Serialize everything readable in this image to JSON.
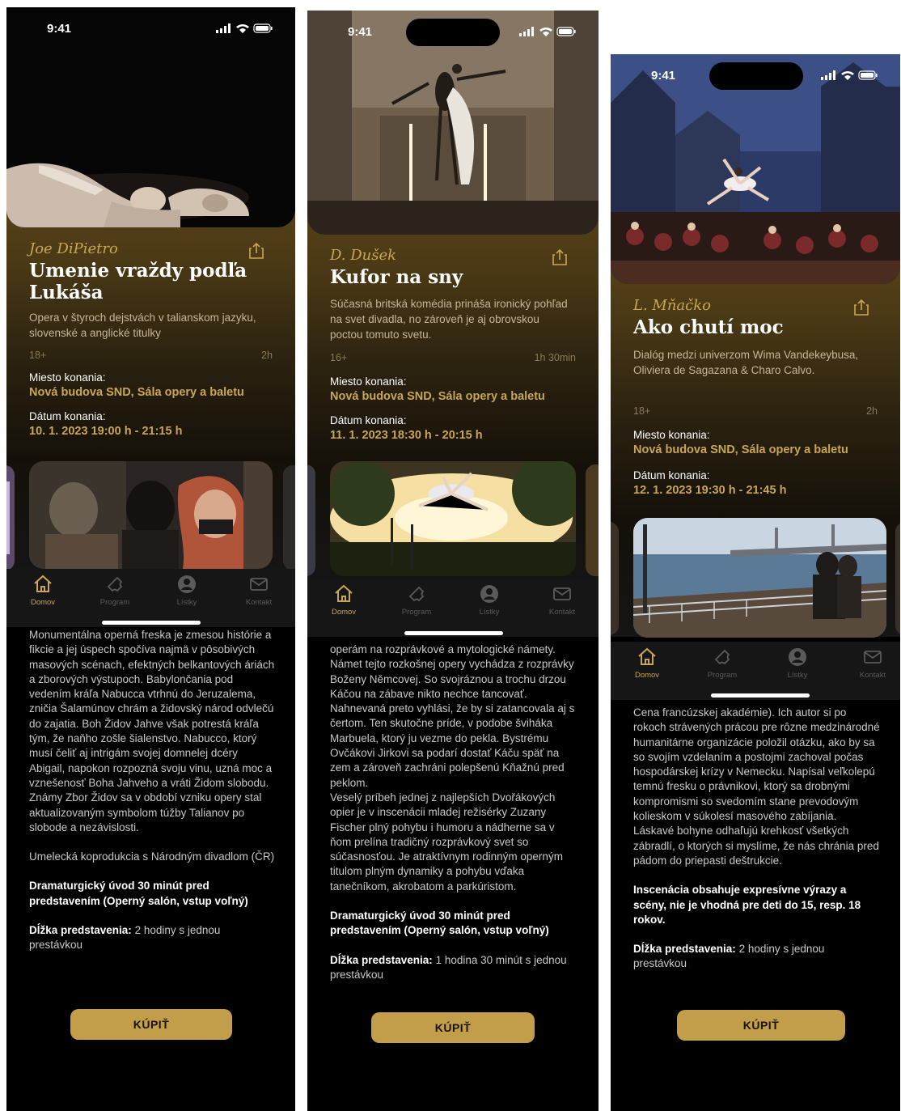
{
  "screens": [
    {
      "status_time": "9:41",
      "author": "Joe DiPietro",
      "title": "Umenie vraždy podľa Lukáša",
      "description": "Opera v štyroch dejstvách v talianskom jazyku, slovenské a anglické titulky",
      "age": "18+",
      "duration": "2h",
      "venue_label": "Miesto konania:",
      "venue": "Nová budova SND, Sála opery a baletu",
      "date_label": "Dátum konania:",
      "date": "10. 1. 2023 19:00 h - 21:15 h",
      "tabs": [
        "Domov",
        "Program",
        "Lístky",
        "Kontakt"
      ],
      "body_text": "Monumentálna operná freska je zmesou histórie a fikcie a jej úspech spočíva najmä v pôsobivých masových scénach, efektných belkantových áriách a zborových výstupoch. Babylončania pod vedením kráľa Nabucca vtrhnú do Jeruzalema, zničia Šalamúnov chrám a židovský národ odvlečú do zajatia. Boh Židov Jahve však potrestá kráľa tým, že naňho zošle šialenstvo. Nabucco, ktorý musí čeliť aj intrigám svojej domnelej dcéry Abigail, napokon rozpozná svoju vinu, uzná moc a vznešenosť Boha Jahveho a vráti Židom slobodu. Známy Zbor Židov sa v období vzniku opery stal aktualizovaným symbolom túžby Talianov po slobode a nezávislosti.",
      "coproduction": "Umelecká koprodukcia s Národným divadlom (ČR)",
      "note_bold": "Dramaturgický úvod 30 minút pred predstavením (Operný salón, vstup voľný)",
      "length_label": "Dĺžka predstavenia:",
      "length_value": " 2 hodiny s jednou prestávkou",
      "buy_label": "KÚPIŤ"
    },
    {
      "status_time": "9:41",
      "author": "D. Dušek",
      "title": "Kufor na sny",
      "description": "Súčasná britská komédia prináša ironický pohľad na svet divadla, no zároveň je aj obrovskou poctou tomuto svetu.",
      "age": "16+",
      "duration": "1h 30min",
      "venue_label": "Miesto konania:",
      "venue": "Nová budova SND, Sála opery a baletu",
      "date_label": "Dátum konania:",
      "date": "11. 1. 2023 18:30 h - 20:15 h",
      "tabs": [
        "Domov",
        "Program",
        "Lístky",
        "Kontakt"
      ],
      "body_text": "operám na rozprávkové a mytologické námety. Námet tejto rozkošnej opery vychádza z rozprávky Boženy Němcovej. So svojráznou a trochu drzou Káčou na zábave nikto nechce tancovať. Nahnevaná preto vyhlási, že by si zatancovala aj s čertom. Ten skutočne príde, v podobe šviháka Marbuela, ktorý ju vezme do pekla. Bystrému Ovčákovi Jirkovi sa podarí dostať Káču späť na zem a zároveň zachráni polepšenú Kňažnú pred peklom.",
      "body_text_2": "Veselý príbeh jednej z najlepších Dvořákových opier je v inscenácii mladej režisérky Zuzany Fischer plný pohybu i humoru a nádherne sa v ňom prelína tradičný rozprávkový svet so súčasnosťou. Je atraktívnym rodinným operným titulom plným dynamiky a pohybu vďaka tanečníkom, akrobatom a parkúristom.",
      "note_bold": "Dramaturgický úvod 30 minút pred predstavením (Operný salón, vstup voľný)",
      "length_label": "Dĺžka predstavenia:",
      "length_value": " 1 hodina 30 minút s jednou prestávkou",
      "buy_label": "KÚPIŤ"
    },
    {
      "status_time": "9:41",
      "author": "L. Mňačko",
      "title": "Ako chutí moc",
      "description": "Dialóg medzi univerzom Wima Vandekeybusa, Oliviera de Sagazana & Charo Calvo.",
      "age": "18+",
      "duration": "2h",
      "venue_label": "Miesto konania:",
      "venue": "Nová budova SND, Sála opery a baletu",
      "date_label": "Dátum konania:",
      "date": "12. 1. 2023 19:30 h - 21:45 h",
      "tabs": [
        "Domov",
        "Program",
        "Lístky",
        "Kontakt"
      ],
      "body_text": "Cena francúzskej akadémie). Ich autor si po rokoch strávených prácou pre rôzne medzinárodné humanitárne organizácie položil otázku, ako by sa so svojím vzdelaním a postojmi zachoval počas hospodárskej krízy v Nemecku. Napísal veľkolepú temnú fresku o právnikovi, ktorý sa drobnými kompromismi so svedomím stane prevodovým kolieskom v súkolesí masového zabíjania. Láskavé bohyne odhaľujú krehkosť všetkých zábradlí, o ktorých si myslíme, že nás chránia pred pádom do priepasti deštrukcie.",
      "note_bold": "Inscenácia obsahuje expresívne výrazy a scény, nie je vhodná pre deti do 15, resp. 18 rokov.",
      "length_label": "Dĺžka predstavenia:",
      "length_value": " 2 hodiny s jednou prestávkou",
      "buy_label": "KÚPIŤ"
    }
  ],
  "colors": {
    "gold": "#c9a654",
    "button": "#c29d4a",
    "tab_inactive": "#5a5a5a",
    "background": "#000000"
  },
  "icons": [
    "share-icon",
    "home-icon",
    "ticket-icon",
    "account-icon",
    "mail-icon",
    "signal-icon",
    "wifi-icon",
    "battery-icon"
  ]
}
